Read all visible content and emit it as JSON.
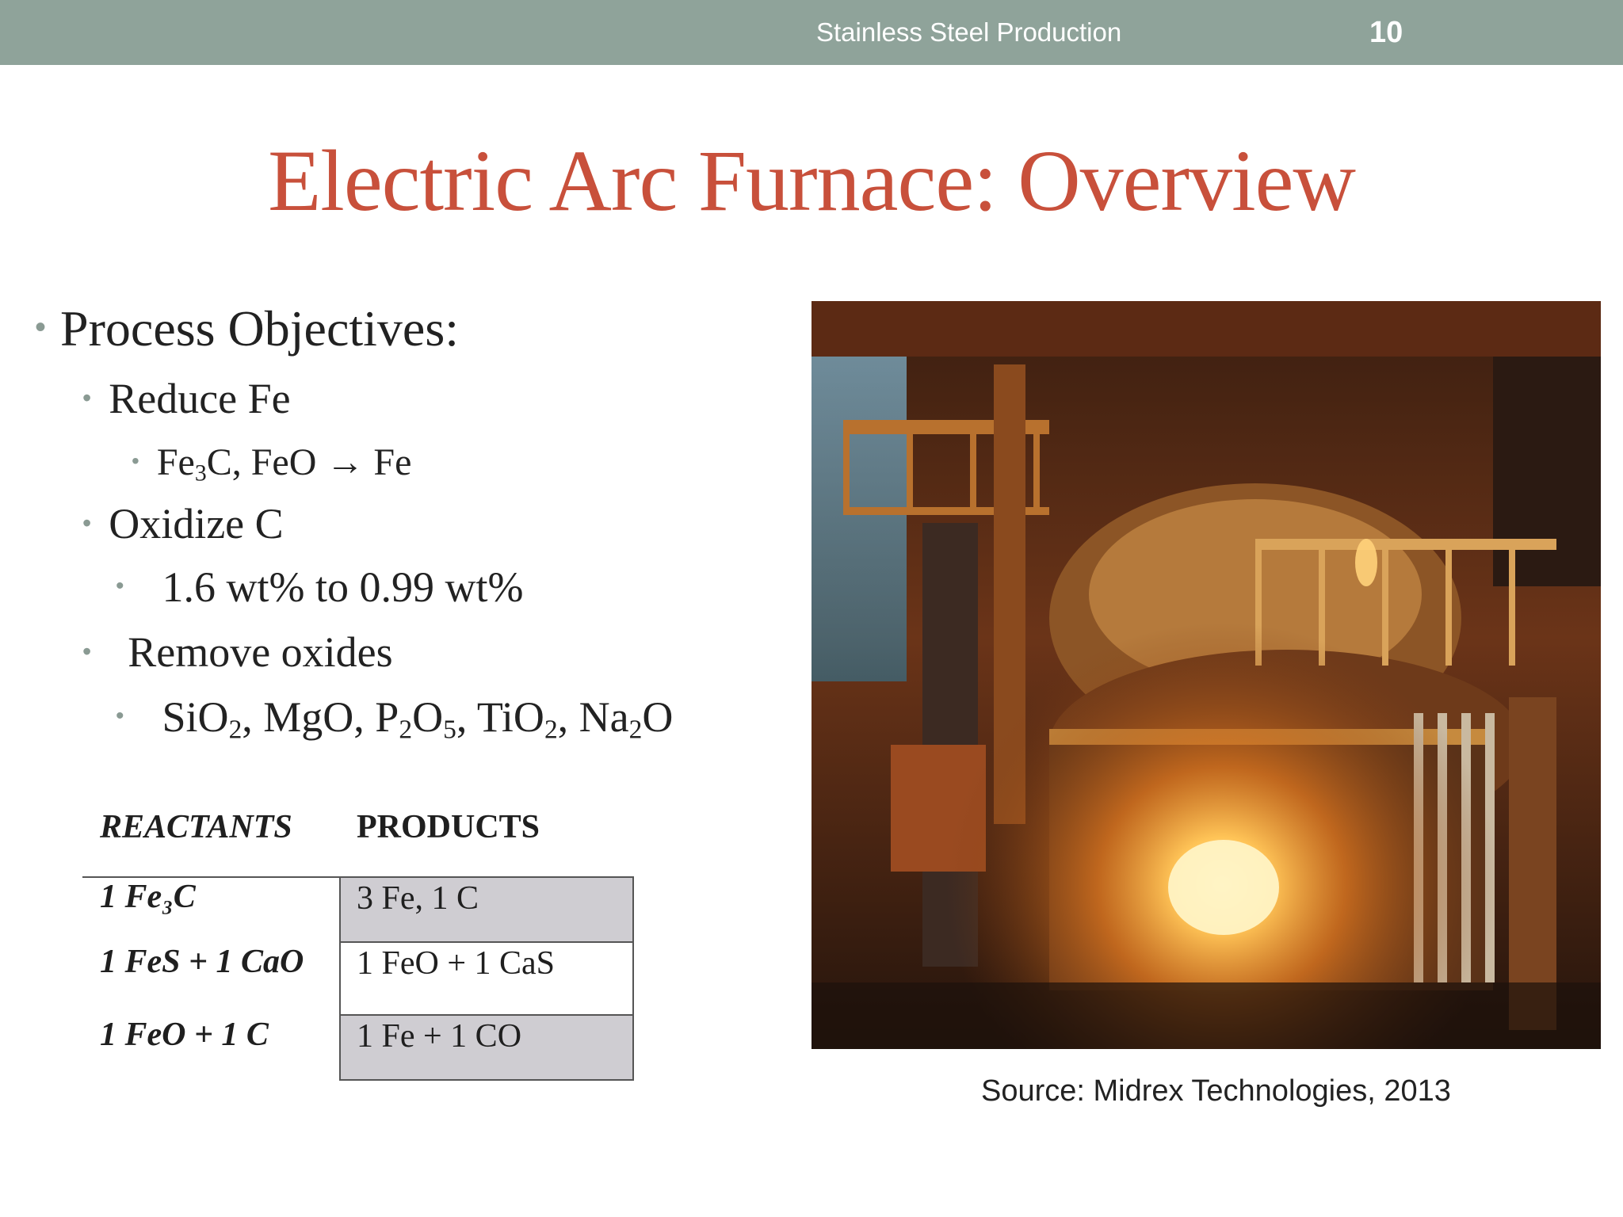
{
  "header": {
    "text": "Stainless Steel Production",
    "page_number": "10"
  },
  "title": "Electric Arc Furnace: Overview",
  "bullets": {
    "process_objectives": "Process Objectives:",
    "reduce_fe": "Reduce Fe",
    "reduce_fe_detail": {
      "part1": "Fe",
      "sub1": "3",
      "part2": "C, FeO → Fe"
    },
    "oxidize_c": "Oxidize C",
    "oxidize_c_detail": "1.6 wt% to 0.99 wt%",
    "remove_oxides": "Remove oxides",
    "oxides_list": {
      "a": "SiO",
      "a_sub": "2",
      "b": ", MgO, P",
      "b_sub": "2",
      "c": "O",
      "c_sub": "5",
      "d": ", TiO",
      "d_sub": "2",
      "e": ", Na",
      "e_sub": "2",
      "f": "O"
    }
  },
  "table": {
    "headers": [
      "REACTANTS",
      "PRODUCTS"
    ],
    "rows": [
      {
        "reactants": "1 Fe₃C",
        "products": "3 Fe, 1 C"
      },
      {
        "reactants": "1 FeS + 1 CaO",
        "products": "1 FeO + 1 CaS"
      },
      {
        "reactants": "1 FeO + 1 C",
        "products": "1 Fe + 1 CO"
      }
    ]
  },
  "image": {
    "name": "electric-arc-furnace-photo"
  },
  "caption": "Source: Midrex Technologies, 2013"
}
